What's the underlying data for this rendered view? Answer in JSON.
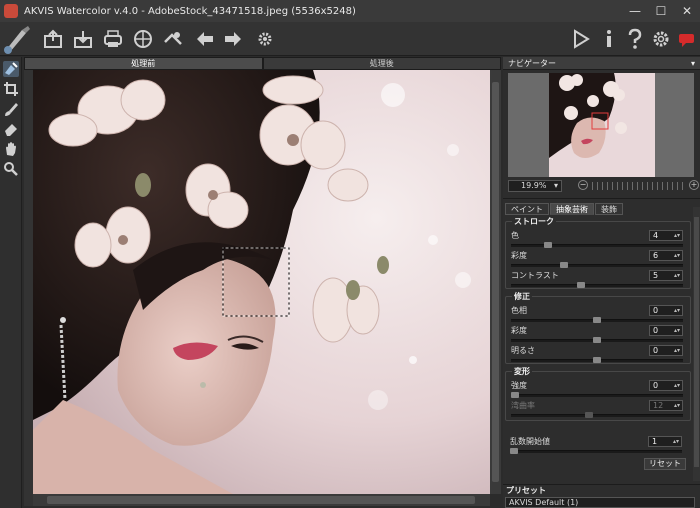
{
  "window": {
    "title": "AKVIS Watercolor v.4.0 - AdobeStock_43471518.jpeg (5536x5248)",
    "buttons": [
      "—",
      "☐",
      "✕"
    ]
  },
  "toolbar": {
    "left_icons": [
      "brush-logo-icon",
      "open-icon",
      "save-icon",
      "print-icon",
      "share-icon",
      "batch-icon",
      "undo-icon",
      "redo-icon",
      "settings-gear-icon"
    ],
    "right_icons": [
      "run-icon",
      "info-icon",
      "help-icon",
      "preferences-icon",
      "notification-icon"
    ]
  },
  "left_tools": [
    "navigator-tool-icon",
    "crop-icon",
    "brush-icon",
    "eraser-icon",
    "hand-icon",
    "zoom-icon"
  ],
  "tabs": {
    "before": "処理前",
    "after": "処理後"
  },
  "navigator": {
    "title": "ナビゲーター",
    "zoom": "19.9%"
  },
  "settings": {
    "tabs": [
      "ペイント",
      "抽象芸術",
      "装飾"
    ],
    "active_tab": 1,
    "groups": {
      "stroke": {
        "label": "ストローク",
        "rows": [
          {
            "label": "色",
            "value": "4",
            "level": 0.2
          },
          {
            "label": "彩度",
            "value": "6",
            "level": 0.3
          },
          {
            "label": "コントラスト",
            "value": "5",
            "level": 0.4
          }
        ]
      },
      "correction": {
        "label": "修正",
        "rows": [
          {
            "label": "色相",
            "value": "0",
            "level": 0.5
          },
          {
            "label": "彩度",
            "value": "0",
            "level": 0.5
          },
          {
            "label": "明るさ",
            "value": "0",
            "level": 0.5
          }
        ]
      },
      "deform": {
        "label": "変形",
        "rows": [
          {
            "label": "強度",
            "value": "0",
            "level": 0.0
          },
          {
            "label": "湾曲率",
            "value": "12",
            "level": 0.45,
            "disabled": true
          }
        ]
      }
    },
    "seed": {
      "label": "乱数開始値",
      "value": "1",
      "level": 0.0
    },
    "reset_label": "リセット"
  },
  "presets": {
    "title": "プリセット",
    "value": "AKVIS Default (1)"
  }
}
